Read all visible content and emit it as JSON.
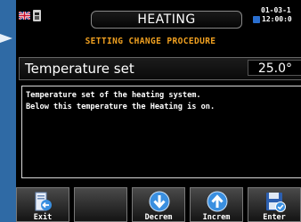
{
  "header": {
    "title": "HEATING",
    "date": "01-03-1",
    "time": "12:00:0"
  },
  "procedure": {
    "subtitle": "SETTING CHANGE PROCEDURE"
  },
  "parameter": {
    "label": "Temperature set",
    "value": "25.0°"
  },
  "description": {
    "line1": "Temperature set of the heating system.",
    "line2": "Below this temperature the Heating is on."
  },
  "footer": {
    "keys": [
      {
        "label": "Exit",
        "icon": "exit-icon"
      },
      {
        "label": "",
        "icon": ""
      },
      {
        "label": "Decrem",
        "icon": "arrow-down-icon"
      },
      {
        "label": "Increm",
        "icon": "arrow-up-icon"
      },
      {
        "label": "Enter",
        "icon": "save-icon"
      }
    ]
  },
  "colors": {
    "background": "#2f6aa5",
    "subtitle": "#f0a020",
    "icon_blue": "#3a8fe0"
  }
}
